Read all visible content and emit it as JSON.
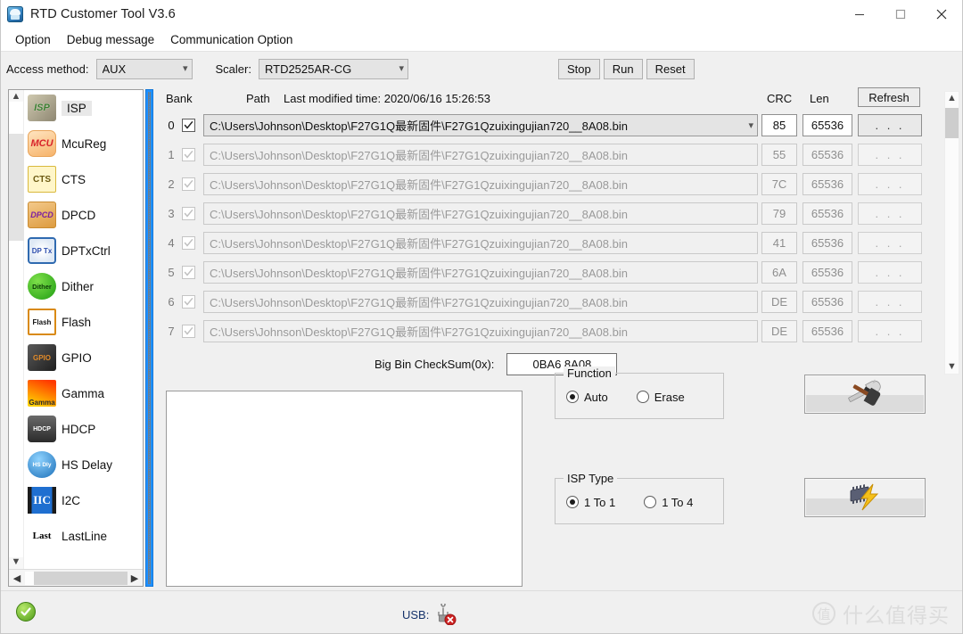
{
  "window": {
    "title": "RTD Customer Tool V3.6",
    "app_icon": "app-icon",
    "minimize": "minimize-icon",
    "maximize": "maximize-icon",
    "close": "close-icon"
  },
  "menu": {
    "items": [
      "Option",
      "Debug message",
      "Communication Option"
    ]
  },
  "toolbar": {
    "access_label": "Access method:",
    "access_value": "AUX",
    "scaler_label": "Scaler:",
    "scaler_value": "RTD2525AR-CG",
    "stop": "Stop",
    "run": "Run",
    "reset": "Reset"
  },
  "sidebar": {
    "items": [
      {
        "label": "ISP",
        "icon": "isp-icon",
        "icon_text": "ISP",
        "icon_class": "ic-isp",
        "selected": true
      },
      {
        "label": "McuReg",
        "icon": "mcu-icon",
        "icon_text": "MCU",
        "icon_class": "ic-mcu",
        "selected": false
      },
      {
        "label": "CTS",
        "icon": "cts-icon",
        "icon_text": "CTS",
        "icon_class": "ic-cts",
        "selected": false
      },
      {
        "label": "DPCD",
        "icon": "dpcd-icon",
        "icon_text": "DPCD",
        "icon_class": "ic-dpcd",
        "selected": false
      },
      {
        "label": "DPTxCtrl",
        "icon": "dptx-icon",
        "icon_text": "DP Tx",
        "icon_class": "ic-dptx",
        "selected": false
      },
      {
        "label": "Dither",
        "icon": "dither-icon",
        "icon_text": "Dither",
        "icon_class": "ic-dither",
        "selected": false
      },
      {
        "label": "Flash",
        "icon": "flash-icon",
        "icon_text": "Flash",
        "icon_class": "ic-flash",
        "selected": false
      },
      {
        "label": "GPIO",
        "icon": "gpio-icon",
        "icon_text": "GPIO",
        "icon_class": "ic-gpio",
        "selected": false
      },
      {
        "label": "Gamma",
        "icon": "gamma-icon",
        "icon_text": "Gamma",
        "icon_class": "ic-gamma",
        "selected": false
      },
      {
        "label": "HDCP",
        "icon": "hdcp-icon",
        "icon_text": "HDCP",
        "icon_class": "ic-hdcp",
        "selected": false
      },
      {
        "label": "HS Delay",
        "icon": "hsdelay-icon",
        "icon_text": "HS Dly",
        "icon_class": "ic-hsd",
        "selected": false
      },
      {
        "label": "I2C",
        "icon": "i2c-icon",
        "icon_text": "IIC",
        "icon_class": "ic-i2c",
        "selected": false
      },
      {
        "label": "LastLine",
        "icon": "lastline-icon",
        "icon_text": "Last",
        "icon_class": "ic-lastline",
        "selected": false
      }
    ],
    "scroll_up": "scroll-up-icon",
    "scroll_down": "scroll-down-icon",
    "scroll_left": "scroll-left-icon",
    "scroll_right": "scroll-right-icon"
  },
  "bank_table": {
    "headers": {
      "bank": "Bank",
      "path": "Path",
      "last_modified": "Last modified time: 2020/06/16 15:26:53",
      "crc": "CRC",
      "len": "Len",
      "refresh": "Refresh"
    },
    "browse_label": ". . .",
    "rows": [
      {
        "num": "0",
        "checked": true,
        "enabled": true,
        "path": "C:\\Users\\Johnson\\Desktop\\F27G1Q最新固件\\F27G1Qzuixingujian720__8A08.bin",
        "crc": "85",
        "len": "65536"
      },
      {
        "num": "1",
        "checked": true,
        "enabled": false,
        "path": "C:\\Users\\Johnson\\Desktop\\F27G1Q最新固件\\F27G1Qzuixingujian720__8A08.bin",
        "crc": "55",
        "len": "65536"
      },
      {
        "num": "2",
        "checked": true,
        "enabled": false,
        "path": "C:\\Users\\Johnson\\Desktop\\F27G1Q最新固件\\F27G1Qzuixingujian720__8A08.bin",
        "crc": "7C",
        "len": "65536"
      },
      {
        "num": "3",
        "checked": true,
        "enabled": false,
        "path": "C:\\Users\\Johnson\\Desktop\\F27G1Q最新固件\\F27G1Qzuixingujian720__8A08.bin",
        "crc": "79",
        "len": "65536"
      },
      {
        "num": "4",
        "checked": true,
        "enabled": false,
        "path": "C:\\Users\\Johnson\\Desktop\\F27G1Q最新固件\\F27G1Qzuixingujian720__8A08.bin",
        "crc": "41",
        "len": "65536"
      },
      {
        "num": "5",
        "checked": true,
        "enabled": false,
        "path": "C:\\Users\\Johnson\\Desktop\\F27G1Q最新固件\\F27G1Qzuixingujian720__8A08.bin",
        "crc": "6A",
        "len": "65536"
      },
      {
        "num": "6",
        "checked": true,
        "enabled": false,
        "path": "C:\\Users\\Johnson\\Desktop\\F27G1Q最新固件\\F27G1Qzuixingujian720__8A08.bin",
        "crc": "DE",
        "len": "65536"
      },
      {
        "num": "7",
        "checked": true,
        "enabled": false,
        "path": "C:\\Users\\Johnson\\Desktop\\F27G1Q最新固件\\F27G1Qzuixingujian720__8A08.bin",
        "crc": "DE",
        "len": "65536"
      }
    ]
  },
  "checksum": {
    "label": "Big Bin CheckSum(0x):",
    "value": "0BA6 8A08"
  },
  "log": {
    "content": ""
  },
  "function_group": {
    "title": "Function",
    "options": [
      {
        "label": "Auto",
        "selected": true
      },
      {
        "label": "Erase",
        "selected": false
      }
    ]
  },
  "isp_type_group": {
    "title": "ISP Type",
    "options": [
      {
        "label": "1 To 1",
        "selected": true
      },
      {
        "label": "1 To 4",
        "selected": false
      }
    ]
  },
  "action_buttons": {
    "tool": "hammer-wrench-icon",
    "flash": "chip-lightning-icon"
  },
  "statusbar": {
    "status_icon": "green-check-icon",
    "usb_label": "USB:",
    "usb_icon": "usb-disconnected-icon",
    "watermark_logo": "值",
    "watermark_text": "什么值得买"
  },
  "colors": {
    "accent": "#1e90ff",
    "window_bg": "#f0f0f0",
    "title_bg": "#ffffff",
    "field_bg": "#e4e4e4",
    "ok_green": "#4f9c18",
    "usb_red": "#cc2222"
  }
}
